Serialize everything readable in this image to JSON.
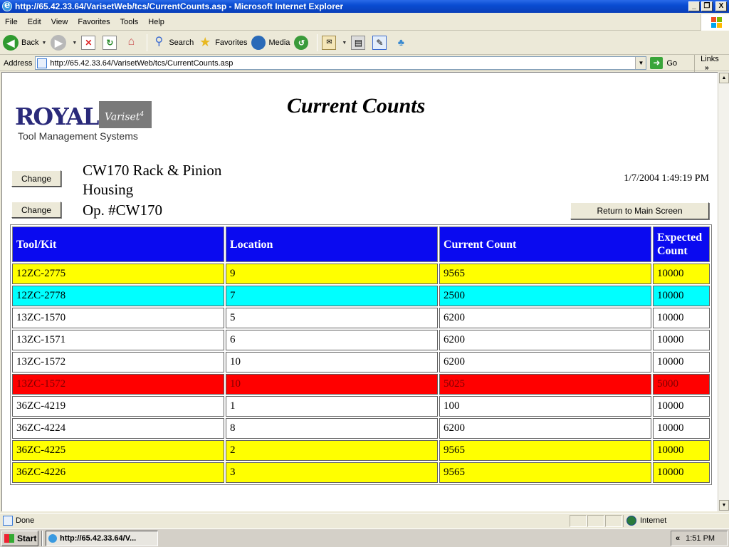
{
  "window": {
    "title": "http://65.42.33.64/VarisetWeb/tcs/CurrentCounts.asp - Microsoft Internet Explorer",
    "min_label": "_",
    "max_label": "❐",
    "close_label": "X"
  },
  "menu": [
    "File",
    "Edit",
    "View",
    "Favorites",
    "Tools",
    "Help"
  ],
  "toolbar": {
    "back": "Back",
    "search": "Search",
    "favorites": "Favorites",
    "media": "Media"
  },
  "address": {
    "label": "Address",
    "url": "http://65.42.33.64/VarisetWeb/tcs/CurrentCounts.asp",
    "go": "Go",
    "links": "Links"
  },
  "logo": {
    "name": "ROYAL",
    "badge": "Variset",
    "badge_sup": "4",
    "subtitle": "Tool Management Systems"
  },
  "page": {
    "title": "Current Counts",
    "change_label": "Change",
    "part_name": "CW170 Rack & Pinion Housing",
    "op_number": "Op. #CW170",
    "datetime": "1/7/2004 1:49:19 PM",
    "return_label": "Return to Main Screen"
  },
  "colors": {
    "header_bg": "#0a0af0",
    "yellow": "#ffff00",
    "cyan": "#00ffff",
    "red": "#ff0000",
    "white": "#ffffff",
    "red_text": "#800000"
  },
  "table": {
    "headers": [
      "Tool/Kit",
      "Location",
      "Current Count",
      "Expected Count"
    ],
    "rows": [
      {
        "tool": "12ZC-2775",
        "location": "9",
        "current": "9565",
        "expected": "10000",
        "status": "yellow"
      },
      {
        "tool": "12ZC-2778",
        "location": "7",
        "current": "2500",
        "expected": "10000",
        "status": "cyan"
      },
      {
        "tool": "13ZC-1570",
        "location": "5",
        "current": "6200",
        "expected": "10000",
        "status": "white"
      },
      {
        "tool": "13ZC-1571",
        "location": "6",
        "current": "6200",
        "expected": "10000",
        "status": "white"
      },
      {
        "tool": "13ZC-1572",
        "location": "10",
        "current": "6200",
        "expected": "10000",
        "status": "white"
      },
      {
        "tool": "13ZC-1572",
        "location": "10",
        "current": "5025",
        "expected": "5000",
        "status": "red"
      },
      {
        "tool": "36ZC-4219",
        "location": "1",
        "current": "100",
        "expected": "10000",
        "status": "white"
      },
      {
        "tool": "36ZC-4224",
        "location": "8",
        "current": "6200",
        "expected": "10000",
        "status": "white"
      },
      {
        "tool": "36ZC-4225",
        "location": "2",
        "current": "9565",
        "expected": "10000",
        "status": "yellow"
      },
      {
        "tool": "36ZC-4226",
        "location": "3",
        "current": "9565",
        "expected": "10000",
        "status": "yellow"
      }
    ]
  },
  "status": {
    "text": "Done",
    "zone": "Internet"
  },
  "taskbar": {
    "start": "Start",
    "task": "http://65.42.33.64/V...",
    "tray_chevron": "«",
    "clock": "1:51 PM"
  }
}
